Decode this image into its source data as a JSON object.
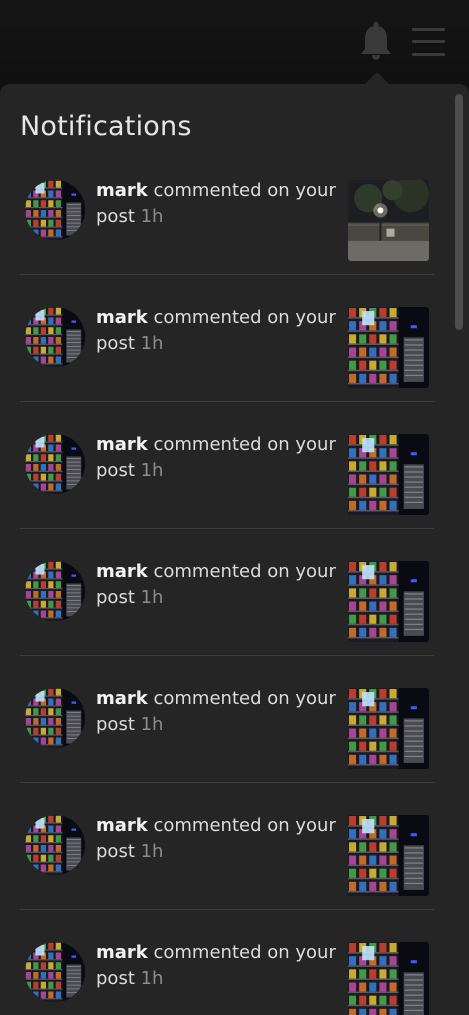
{
  "header": {
    "bell_icon": "bell-icon",
    "menu_icon": "hamburger-menu-icon"
  },
  "panel": {
    "title": "Notifications"
  },
  "notifications": [
    {
      "user": "mark",
      "action": "commented on your post",
      "time": "1h",
      "thumbnail": "street-lamp-night"
    },
    {
      "user": "mark",
      "action": "commented on your post",
      "time": "1h",
      "thumbnail": "vending-machine"
    },
    {
      "user": "mark",
      "action": "commented on your post",
      "time": "1h",
      "thumbnail": "vending-machine"
    },
    {
      "user": "mark",
      "action": "commented on your post",
      "time": "1h",
      "thumbnail": "vending-machine"
    },
    {
      "user": "mark",
      "action": "commented on your post",
      "time": "1h",
      "thumbnail": "vending-machine"
    },
    {
      "user": "mark",
      "action": "commented on your post",
      "time": "1h",
      "thumbnail": "vending-machine"
    },
    {
      "user": "mark",
      "action": "commented on your post",
      "time": "1h",
      "thumbnail": "vending-machine"
    }
  ],
  "colors": {
    "background": "#111111",
    "panel": "#252525",
    "text": "#dcdcdc",
    "muted": "#8c8c8c",
    "icon": "#3a3a3a"
  }
}
